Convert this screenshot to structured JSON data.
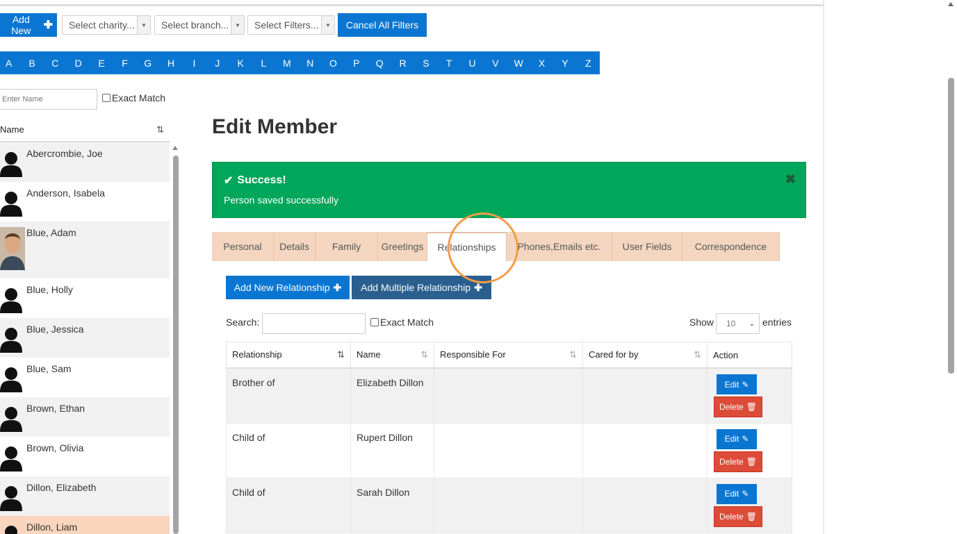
{
  "toolbar": {
    "add_new_label": "Add New",
    "charity_placeholder": "Select charity...",
    "branch_placeholder": "Select branch...",
    "filters_placeholder": "Select Filters...",
    "cancel_filters_label": "Cancel All Filters"
  },
  "alphabet": [
    "A",
    "B",
    "C",
    "D",
    "E",
    "F",
    "G",
    "H",
    "I",
    "J",
    "K",
    "L",
    "M",
    "N",
    "O",
    "P",
    "Q",
    "R",
    "S",
    "T",
    "U",
    "V",
    "W",
    "X",
    "Y",
    "Z"
  ],
  "name_filter": {
    "placeholder": "Enter Name",
    "exact_match_label": "Exact Match"
  },
  "member_list": {
    "header": "Name",
    "members": [
      {
        "name": "Abercrombie, Joe",
        "photo": "silhouette"
      },
      {
        "name": "Anderson, Isabela",
        "photo": "silhouette"
      },
      {
        "name": "Blue, Adam",
        "photo": "photo"
      },
      {
        "name": "Blue, Holly",
        "photo": "silhouette"
      },
      {
        "name": "Blue, Jessica",
        "photo": "silhouette"
      },
      {
        "name": "Blue, Sam",
        "photo": "silhouette"
      },
      {
        "name": "Brown, Ethan",
        "photo": "silhouette"
      },
      {
        "name": "Brown, Olivia",
        "photo": "silhouette"
      },
      {
        "name": "Dillon, Elizabeth",
        "photo": "silhouette"
      },
      {
        "name": "Dillon, Liam",
        "photo": "silhouette",
        "selected": true
      }
    ]
  },
  "page": {
    "title": "Edit Member"
  },
  "alert": {
    "heading": "Success!",
    "message": "Person saved successfully",
    "color": "#00a65a"
  },
  "tabs": [
    {
      "label": "Personal"
    },
    {
      "label": "Details"
    },
    {
      "label": "Family"
    },
    {
      "label": "Greetings"
    },
    {
      "label": "Relationships",
      "active": true
    },
    {
      "label": "Phones,Emails etc."
    },
    {
      "label": "User Fields"
    },
    {
      "label": "Correspondence"
    }
  ],
  "relationships": {
    "add_new_label": "Add New Relationship",
    "add_multiple_label": "Add Multiple Relationship",
    "search_label": "Search:",
    "exact_match_label": "Exact Match",
    "show_label": "Show",
    "entries_value": "10",
    "entries_label": "entries",
    "columns": [
      "Relationship",
      "Name",
      "Responsible For",
      "Cared for by",
      "Action"
    ],
    "rows": [
      {
        "relationship": "Brother of",
        "name": "Elizabeth Dillon",
        "responsible_for": "",
        "cared_for_by": ""
      },
      {
        "relationship": "Child of",
        "name": "Rupert Dillon",
        "responsible_for": "",
        "cared_for_by": ""
      },
      {
        "relationship": "Child of",
        "name": "Sarah Dillon",
        "responsible_for": "",
        "cared_for_by": ""
      }
    ],
    "edit_label": "Edit",
    "delete_label": "Delete"
  },
  "colors": {
    "primary": "#0a76d1",
    "danger": "#dd4b39",
    "tab_bg": "#f4d6c0",
    "highlight_ring": "#f39c44"
  }
}
